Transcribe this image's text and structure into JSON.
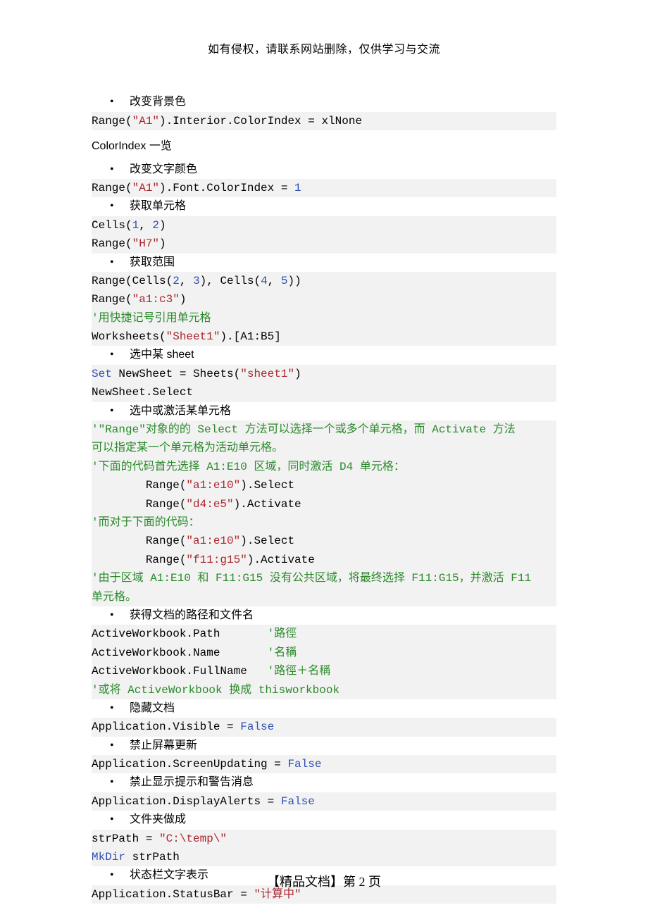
{
  "header": {
    "disclaimer": "如有侵权，请联系网站删除，仅供学习与交流"
  },
  "sections": {
    "bg_color": {
      "bullet": "改变背景色",
      "code": {
        "pre": "Range(",
        "str": "\"A1\"",
        "post": ").Interior.ColorIndex = xlNone"
      }
    },
    "colorindex_link": "ColorIndex 一览",
    "font_color": {
      "bullet": "改变文字颜色",
      "code": {
        "pre": "Range(",
        "str": "\"A1\"",
        "post": ").Font.ColorIndex = ",
        "num": "1"
      }
    },
    "get_cell": {
      "bullet": "获取单元格",
      "line1": {
        "pre": "Cells(",
        "n1": "1",
        "mid": ", ",
        "n2": "2",
        "post": ")"
      },
      "line2": {
        "pre": "Range(",
        "str": "\"H7\"",
        "post": ")"
      }
    },
    "get_range": {
      "bullet": "获取范围",
      "line1": {
        "pre": "Range(Cells(",
        "n1": "2",
        "m1": ", ",
        "n2": "3",
        "m2": "), Cells(",
        "n3": "4",
        "m3": ", ",
        "n4": "5",
        "post": "))"
      },
      "line2": {
        "pre": "Range(",
        "str": "\"a1:c3\"",
        "post": ")"
      },
      "cmt": "'用快捷记号引用单元格",
      "line3": {
        "pre": "Worksheets(",
        "str": "\"Sheet1\"",
        "post": ").[A1:B5]"
      }
    },
    "select_sheet": {
      "bullet": "选中某",
      "bullet_sans": " sheet",
      "line1": {
        "kw": "Set",
        "mid": " NewSheet = Sheets(",
        "str": "\"sheet1\"",
        "post": ")"
      },
      "line2": "NewSheet.Select"
    },
    "select_activate": {
      "bullet": "选中或激活某单元格",
      "cmt1a": "'\"Range\"对象的的 Select 方法可以选择一个或多个单元格，而 Activate 方法",
      "cmt1b": "可以指定某一个单元格为活动单元格。",
      "cmt2": "'下面的代码首先选择 A1:E10 区域，同时激活 D4 单元格：",
      "l1": {
        "pre": "        Range(",
        "str": "\"a1:e10\"",
        "post": ").Select"
      },
      "l2": {
        "pre": "        Range(",
        "str": "\"d4:e5\"",
        "post": ").Activate"
      },
      "cmt3": "'而对于下面的代码：",
      "l3": {
        "pre": "        Range(",
        "str": "\"a1:e10\"",
        "post": ").Select"
      },
      "l4": {
        "pre": "        Range(",
        "str": "\"f11:g15\"",
        "post": ").Activate"
      },
      "cmt4a": "'由于区域 A1:E10 和 F11:G15 没有公共区域，将最终选择 F11:G15，并激活 F11",
      "cmt4b": "单元格。"
    },
    "path_name": {
      "bullet": "获得文档的路径和文件名",
      "l1": {
        "pre": "ActiveWorkbook.Path       ",
        "cmt": "'路徑"
      },
      "l2": {
        "pre": "ActiveWorkbook.Name       ",
        "cmt": "'名稱"
      },
      "l3": {
        "pre": "ActiveWorkbook.FullName   ",
        "cmt": "'路徑＋名稱"
      },
      "cmt_final": "'或将 ActiveWorkbook 换成 thisworkbook"
    },
    "hide_doc": {
      "bullet": "隐藏文档",
      "code": {
        "pre": "Application.Visible = ",
        "kw": "False"
      }
    },
    "screen_update": {
      "bullet": "禁止屏幕更新",
      "code": {
        "pre": "Application.ScreenUpdating = ",
        "kw": "False"
      }
    },
    "display_alerts": {
      "bullet": "禁止显示提示和警告消息",
      "code": {
        "pre": "Application.DisplayAlerts = ",
        "kw": "False"
      }
    },
    "mkdir": {
      "bullet": "文件夹做成",
      "l1": {
        "pre": "strPath = ",
        "str": "\"C:\\temp\\\""
      },
      "l2": {
        "kw": "MkDir",
        "post": " strPath"
      }
    },
    "status_bar": {
      "bullet": "状态栏文字表示",
      "code": {
        "pre": "Application.StatusBar = ",
        "str": "\"计算中\""
      }
    }
  },
  "footer": {
    "label": "【精品文档】",
    "page_text": "第 2 页"
  }
}
